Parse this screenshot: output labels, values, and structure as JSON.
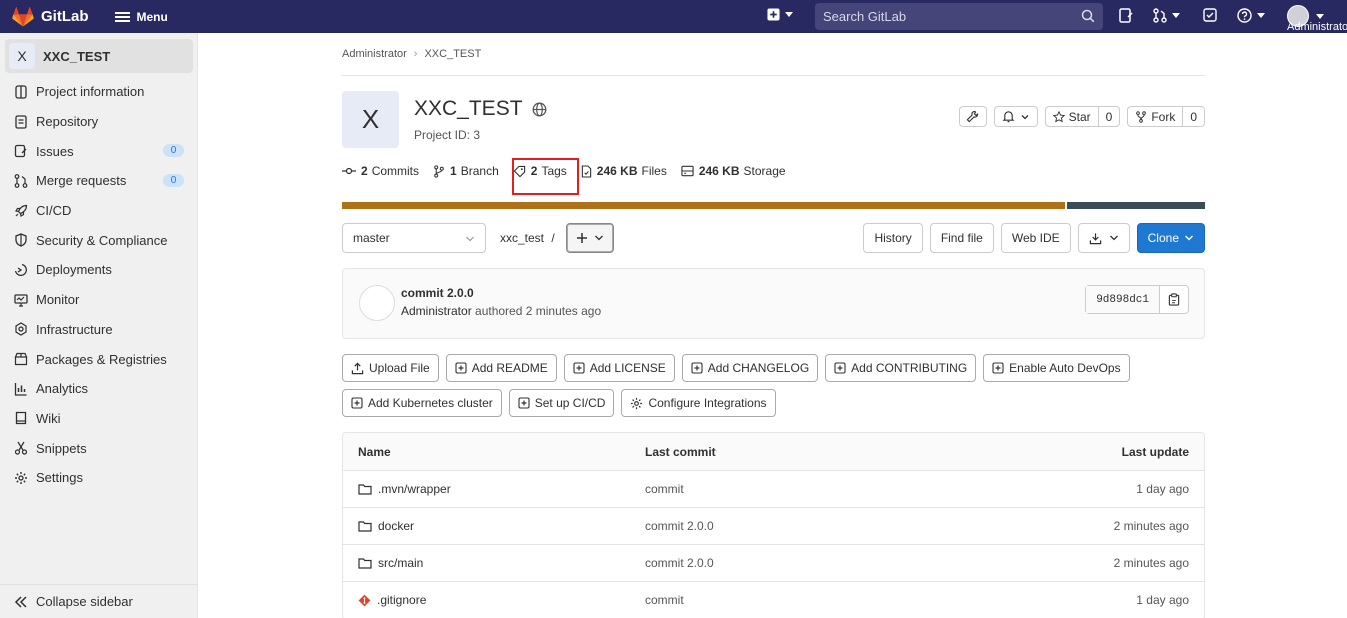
{
  "topbar": {
    "logo_text": "GitLab",
    "menu_label": "Menu",
    "search_placeholder": "Search GitLab",
    "user_label": "Administrator"
  },
  "sidebar": {
    "project_initial": "X",
    "project_name": "XXC_TEST",
    "items": [
      {
        "label": "Project information",
        "icon": "info-icon"
      },
      {
        "label": "Repository",
        "icon": "doc-icon"
      },
      {
        "label": "Issues",
        "icon": "issues-icon",
        "badge": "0"
      },
      {
        "label": "Merge requests",
        "icon": "merge-request-icon",
        "badge": "0"
      },
      {
        "label": "CI/CD",
        "icon": "rocket-icon"
      },
      {
        "label": "Security & Compliance",
        "icon": "shield-icon"
      },
      {
        "label": "Deployments",
        "icon": "deployments-icon"
      },
      {
        "label": "Monitor",
        "icon": "monitor-icon"
      },
      {
        "label": "Infrastructure",
        "icon": "infrastructure-icon"
      },
      {
        "label": "Packages & Registries",
        "icon": "package-icon"
      },
      {
        "label": "Analytics",
        "icon": "chart-icon"
      },
      {
        "label": "Wiki",
        "icon": "book-icon"
      },
      {
        "label": "Snippets",
        "icon": "scissors-icon"
      },
      {
        "label": "Settings",
        "icon": "gear-icon"
      }
    ],
    "collapse_label": "Collapse sidebar"
  },
  "breadcrumb": [
    "Administrator",
    "XXC_TEST"
  ],
  "project": {
    "initial": "X",
    "name": "XXC_TEST",
    "id_text": "Project ID: 3",
    "star_label": "Star",
    "star_count": "0",
    "fork_label": "Fork",
    "fork_count": "0"
  },
  "stats": {
    "commits_num": "2",
    "commits_label": "Commits",
    "branch_num": "1",
    "branch_label": "Branch",
    "tags_num": "2",
    "tags_label": "Tags",
    "files_num": "246 KB",
    "files_label": "Files",
    "storage_num": "246 KB",
    "storage_label": "Storage"
  },
  "languages": [
    {
      "fraction": 0.84,
      "color": "#b07219"
    },
    {
      "fraction": 0.16,
      "color": "#384d54"
    }
  ],
  "repo": {
    "branch": "master",
    "path": "xxc_test",
    "path_sep": "/",
    "history_label": "History",
    "find_file_label": "Find file",
    "web_ide_label": "Web IDE",
    "clone_label": "Clone"
  },
  "last_commit": {
    "title": "commit 2.0.0",
    "author": "Administrator",
    "meta": "authored 2 minutes ago",
    "sha": "9d898dc1"
  },
  "quick_actions": {
    "row1": [
      "Upload File",
      "Add README",
      "Add LICENSE",
      "Add CHANGELOG",
      "Add CONTRIBUTING",
      "Enable Auto DevOps"
    ],
    "row2": [
      "Add Kubernetes cluster",
      "Set up CI/CD",
      "Configure Integrations"
    ]
  },
  "table": {
    "headers": {
      "name": "Name",
      "commit": "Last commit",
      "update": "Last update"
    },
    "rows": [
      {
        "name": ".mvn/wrapper",
        "type": "folder",
        "commit": "commit",
        "update": "1 day ago"
      },
      {
        "name": "docker",
        "type": "folder",
        "commit": "commit 2.0.0",
        "update": "2 minutes ago"
      },
      {
        "name": "src/main",
        "type": "folder",
        "commit": "commit 2.0.0",
        "update": "2 minutes ago"
      },
      {
        "name": ".gitignore",
        "type": "git",
        "commit": "commit",
        "update": "1 day ago"
      }
    ]
  },
  "colors": {
    "navbar": "#292961",
    "primary": "#1f78d1",
    "highlight": "#e02020"
  }
}
